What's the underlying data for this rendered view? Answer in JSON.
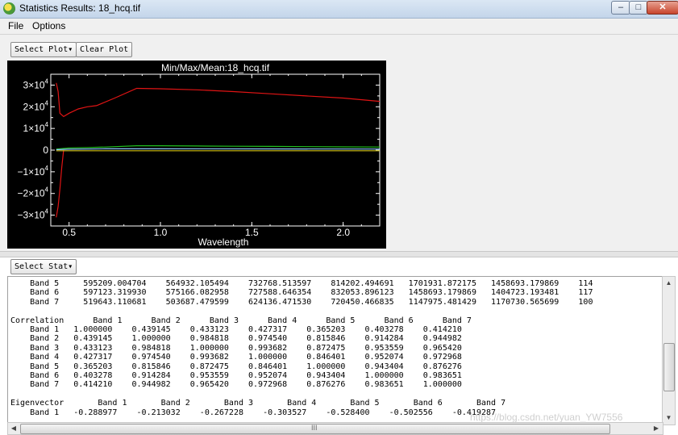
{
  "window": {
    "title": "Statistics Results: 18_hcq.tif"
  },
  "menu": {
    "file": "File",
    "options": "Options"
  },
  "toolbar": {
    "select_plot": "Select Plot",
    "clear_plot": "Clear Plot",
    "select_stat": "Select Stat"
  },
  "icons": {
    "dropdown": "chevron-down-icon",
    "minimize": "minimize-icon",
    "maximize": "maximize-icon",
    "close": "close-icon"
  },
  "chart_data": {
    "type": "line",
    "title": "Min/Max/Mean:18_hcq.tif",
    "xlabel": "Wavelength",
    "ylabel": "",
    "xlim": [
      0.4,
      2.2
    ],
    "ylim": [
      -35000,
      35000
    ],
    "xticks": [
      0.5,
      1.0,
      1.5,
      2.0
    ],
    "xtick_labels": [
      "0.5",
      "1.0",
      "1.5",
      "2.0"
    ],
    "yticks": [
      30000,
      20000,
      10000,
      0,
      -10000,
      -20000,
      -30000
    ],
    "ytick_labels": [
      {
        "mant": "3×10",
        "exp": "4"
      },
      {
        "mant": "2×10",
        "exp": "4"
      },
      {
        "mant": "1×10",
        "exp": "4"
      },
      {
        "mant": "0",
        "exp": ""
      },
      {
        "mant": "−1×10",
        "exp": "4"
      },
      {
        "mant": "−2×10",
        "exp": "4"
      },
      {
        "mant": "−3×10",
        "exp": "4"
      }
    ],
    "background": "#000000",
    "axis_color": "#ffffff",
    "series": [
      {
        "color": "#e01414",
        "x": [
          0.43,
          0.44,
          0.45,
          0.47,
          0.5,
          0.55,
          0.6,
          0.65,
          0.75,
          0.87,
          1.0,
          1.2,
          1.4,
          1.6,
          1.8,
          2.0,
          2.2
        ],
        "y": [
          31000,
          27000,
          17000,
          15500,
          17000,
          19000,
          20000,
          20500,
          24000,
          28500,
          28300,
          27800,
          27000,
          26000,
          25000,
          24000,
          22500
        ]
      },
      {
        "color": "#e01414",
        "x": [
          0.43,
          0.44,
          0.45,
          0.46,
          0.47
        ],
        "y": [
          -31000,
          -26000,
          -18000,
          -8000,
          0
        ]
      },
      {
        "color": "#20c020",
        "x": [
          0.43,
          0.5,
          0.6,
          0.7,
          0.87,
          1.0,
          1.2,
          1.4,
          1.6,
          1.8,
          2.0,
          2.2
        ],
        "y": [
          500,
          1000,
          1200,
          1400,
          2000,
          2000,
          1900,
          1800,
          1700,
          1600,
          1500,
          1400
        ]
      },
      {
        "color": "#d4c419",
        "x": [
          0.43,
          0.7,
          1.0,
          1.5,
          2.2
        ],
        "y": [
          -300,
          -300,
          -300,
          -300,
          -300
        ]
      },
      {
        "color": "#8ec8ff",
        "x": [
          0.43,
          0.5,
          0.7,
          1.0,
          1.5,
          2.2
        ],
        "y": [
          200,
          400,
          600,
          600,
          550,
          500
        ]
      }
    ]
  },
  "stats": {
    "lines": [
      "    Band 5     595209.004704    564932.105494    732768.513597    814202.494691   1701931.872175   1458693.179869    114",
      "    Band 6     597123.319930    575166.082958    727588.646354    832053.896123   1458693.179869   1404723.193481    117",
      "    Band 7     519643.110681    503687.479599    624136.471530    720450.466835   1147975.481429   1170730.565699    100",
      "",
      "Correlation      Band 1      Band 2      Band 3      Band 4      Band 5      Band 6      Band 7",
      "    Band 1   1.000000    0.439145    0.433123    0.427317    0.365203    0.403278    0.414210",
      "    Band 2   0.439145    1.000000    0.984818    0.974540    0.815846    0.914284    0.944982",
      "    Band 3   0.433123    0.984818    1.000000    0.993682    0.872475    0.953559    0.965420",
      "    Band 4   0.427317    0.974540    0.993682    1.000000    0.846401    0.952074    0.972968",
      "    Band 5   0.365203    0.815846    0.872475    0.846401    1.000000    0.943404    0.876276",
      "    Band 6   0.403278    0.914284    0.953559    0.952074    0.943404    1.000000    0.983651",
      "    Band 7   0.414210    0.944982    0.965420    0.972968    0.876276    0.983651    1.000000",
      "",
      "Eigenvector       Band 1       Band 2       Band 3       Band 4       Band 5       Band 6       Band 7",
      "    Band 1   -0.288977    -0.213032    -0.267228    -0.303527    -0.528400    -0.502556    -0.419287"
    ]
  },
  "scrollbar": {
    "up": "▲",
    "down": "▼",
    "left": "◀",
    "right": "▶",
    "grip": "III"
  },
  "watermark": "https://blog.csdn.net/yuan_YW7556"
}
